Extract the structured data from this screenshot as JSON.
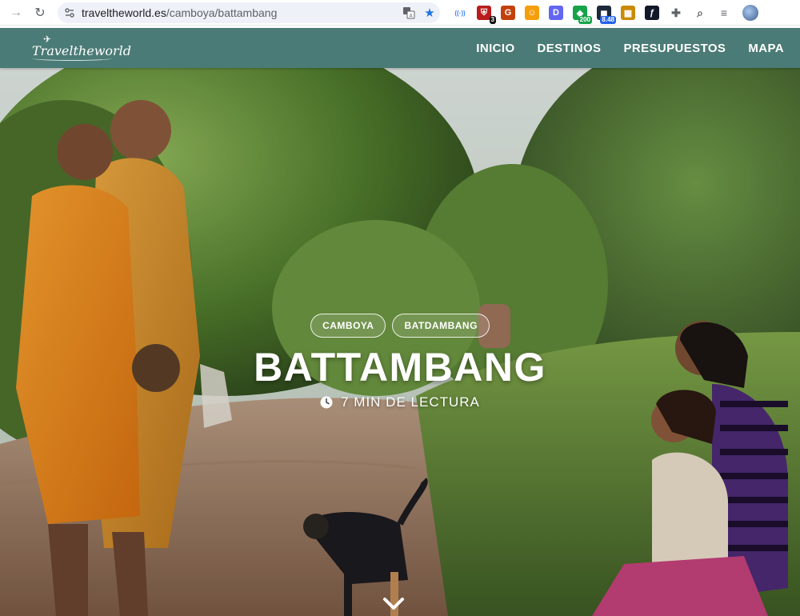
{
  "browser": {
    "url_host": "traveltheworld.es",
    "url_path": "/camboya/battambang",
    "extensions": [
      {
        "icon": "broadcast-icon",
        "color": "#3b82f6"
      },
      {
        "icon": "shield-icon",
        "color": "#b91c1c",
        "badge": "3"
      },
      {
        "icon": "grammar-icon",
        "color": "#c2410c"
      },
      {
        "icon": "smiley-icon",
        "color": "#f59e0b"
      },
      {
        "icon": "d-icon",
        "color": "#6366f1"
      },
      {
        "icon": "green-ext-icon",
        "color": "#16a34a",
        "badge": "200"
      },
      {
        "icon": "dark-ext-icon",
        "color": "#1e293b",
        "badge": "8.48"
      },
      {
        "icon": "color-ext-icon",
        "color": "#ca8a04"
      },
      {
        "icon": "function-icon",
        "color": "#111827"
      },
      {
        "icon": "puzzle-icon",
        "color": "#5f6368"
      },
      {
        "icon": "screenshot-icon",
        "color": "#5f6368"
      },
      {
        "icon": "playlist-icon",
        "color": "#5f6368"
      }
    ]
  },
  "site": {
    "logo_text": "Traveltheworld",
    "nav": [
      "INICIO",
      "DESTINOS",
      "PRESUPUESTOS",
      "MAPA"
    ]
  },
  "hero": {
    "tags": [
      "CAMBOYA",
      "BATDAMBANG"
    ],
    "title": "BATTAMBANG",
    "reading_time": "7 MIN DE LECTURA"
  },
  "colors": {
    "header_bg": "#4b7b76",
    "accent": "#1a73e8"
  }
}
